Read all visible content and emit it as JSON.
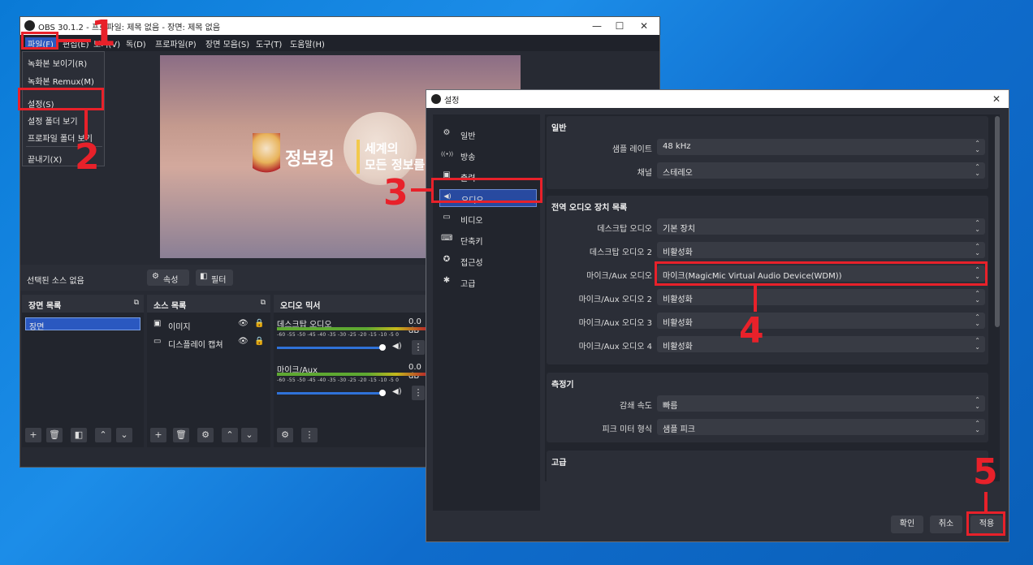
{
  "obs": {
    "title": "OBS 30.1.2 - 프로파일: 제목 없음 - 장면: 제목 없음",
    "menu": [
      "파일(F)",
      "편집(E)",
      "보기(V)",
      "독(D)",
      "프로파일(P)",
      "장면 모음(S)",
      "도구(T)",
      "도움말(H)"
    ],
    "file_menu": [
      "녹화본 보이기(R)",
      "녹화본 Remux(M)",
      "설정(S)",
      "설정 폴더 보기",
      "프로파일 폴더 보기",
      "끝내기(X)"
    ],
    "preview": {
      "logo_text": "정보킹",
      "tagline_1": "세계의",
      "tagline_2": "모든 정보를"
    },
    "status": {
      "no_source": "선택된 소스 없음",
      "properties": "속성",
      "filters": "필터"
    },
    "scenes": {
      "header": "장면 목록",
      "items": [
        "장면"
      ]
    },
    "sources": {
      "header": "소스 목록",
      "items": [
        "이미지",
        "디스플레이 캡쳐"
      ]
    },
    "mixer": {
      "header": "오디오 믹서",
      "channels": [
        {
          "name": "데스크탑 오디오",
          "level": "0.0 dB"
        },
        {
          "name": "마이크/Aux",
          "level": "0.0 dB"
        }
      ],
      "scale": "-60 -55 -50 -45 -40 -35 -30 -25 -20 -15 -10 -5 0"
    }
  },
  "settings": {
    "title": "설정",
    "sidebar": [
      {
        "label": "일반",
        "icon": "gear-icon",
        "glyph": "⚙"
      },
      {
        "label": "방송",
        "icon": "antenna-icon",
        "glyph": "((•))"
      },
      {
        "label": "출력",
        "icon": "output-icon",
        "glyph": "▣"
      },
      {
        "label": "오디오",
        "icon": "speaker-icon",
        "glyph": "◀)"
      },
      {
        "label": "비디오",
        "icon": "monitor-icon",
        "glyph": "▭"
      },
      {
        "label": "단축키",
        "icon": "keyboard-icon",
        "glyph": "⌨"
      },
      {
        "label": "접근성",
        "icon": "accessibility-icon",
        "glyph": "✪"
      },
      {
        "label": "고급",
        "icon": "wrench-icon",
        "glyph": "✱"
      }
    ],
    "selected": "오디오",
    "groups": {
      "general": {
        "title": "일반",
        "rows": [
          {
            "label": "샘플 레이트",
            "value": "48 kHz"
          },
          {
            "label": "채널",
            "value": "스테레오"
          }
        ]
      },
      "global_devices": {
        "title": "전역 오디오 장치 목록",
        "rows": [
          {
            "label": "데스크탑 오디오",
            "value": "기본 장치"
          },
          {
            "label": "데스크탑 오디오 2",
            "value": "비활성화"
          },
          {
            "label": "마이크/Aux 오디오",
            "value": "마이크(MagicMic Virtual Audio Device(WDM))"
          },
          {
            "label": "마이크/Aux 오디오 2",
            "value": "비활성화"
          },
          {
            "label": "마이크/Aux 오디오 3",
            "value": "비활성화"
          },
          {
            "label": "마이크/Aux 오디오 4",
            "value": "비활성화"
          }
        ]
      },
      "meters": {
        "title": "측정기",
        "rows": [
          {
            "label": "감쇄 속도",
            "value": "빠름"
          },
          {
            "label": "피크 미터 형식",
            "value": "샘플 피크"
          }
        ]
      },
      "advanced": {
        "title": "고급"
      }
    },
    "buttons": {
      "ok": "확인",
      "cancel": "취소",
      "apply": "적용"
    }
  },
  "annotations": [
    "1",
    "2",
    "3",
    "4",
    "5"
  ],
  "colors": {
    "highlight": "#e8212a",
    "selected": "#284aa0",
    "panel": "#22252d"
  }
}
